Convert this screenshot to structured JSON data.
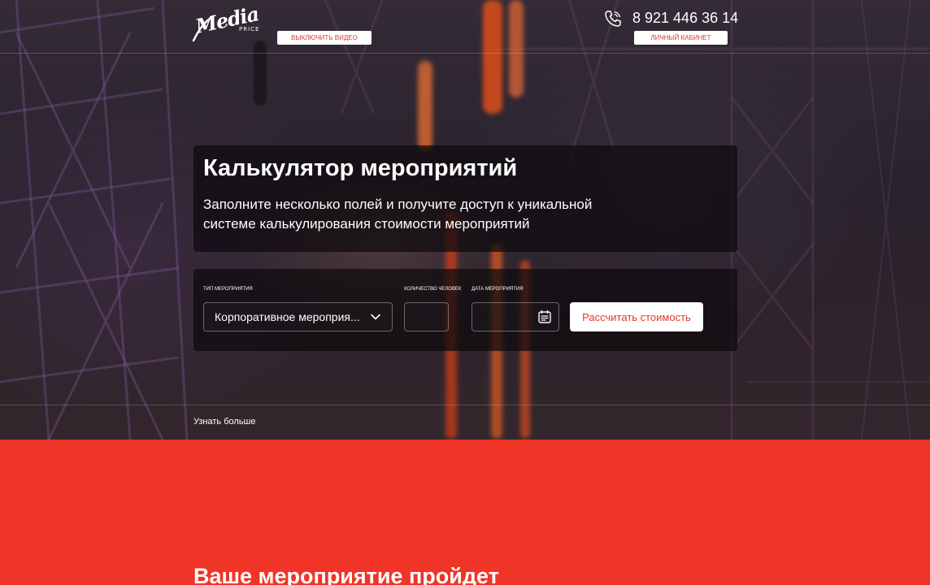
{
  "brand": {
    "logo_text": "Media",
    "logo_sub": "PRICE"
  },
  "header": {
    "video_button": "ВЫКЛЮЧИТЬ ВИДЕО",
    "phone": "8 921 446 36 14",
    "cabinet_button": "ЛИЧНЫЙ КАБИНЕТ"
  },
  "intro": {
    "title": "Калькулятор мероприятий",
    "text": "Заполните несколько полей и получите доступ к уникальной системе калькулирования стоимости мероприятий"
  },
  "form": {
    "type_label": "ТИП МЕРОПРИЯТИЯ",
    "type_value": "Корпоративное мероприя...",
    "count_label": "КОЛИЧЕСТВО ЧЕЛОВЕК",
    "count_value": "",
    "date_label": "ДАТА МЕРОПРИЯТИЯ",
    "date_value": "",
    "submit_label": "Рассчитать стоимость"
  },
  "learn_more": "Узнать больше",
  "next_section": {
    "heading": "Ваше мероприятие пройдет"
  },
  "colors": {
    "accent": "#f03427",
    "button_text": "#e3362a"
  },
  "icons": [
    "phone-icon",
    "chevron-down-icon",
    "calendar-icon"
  ]
}
